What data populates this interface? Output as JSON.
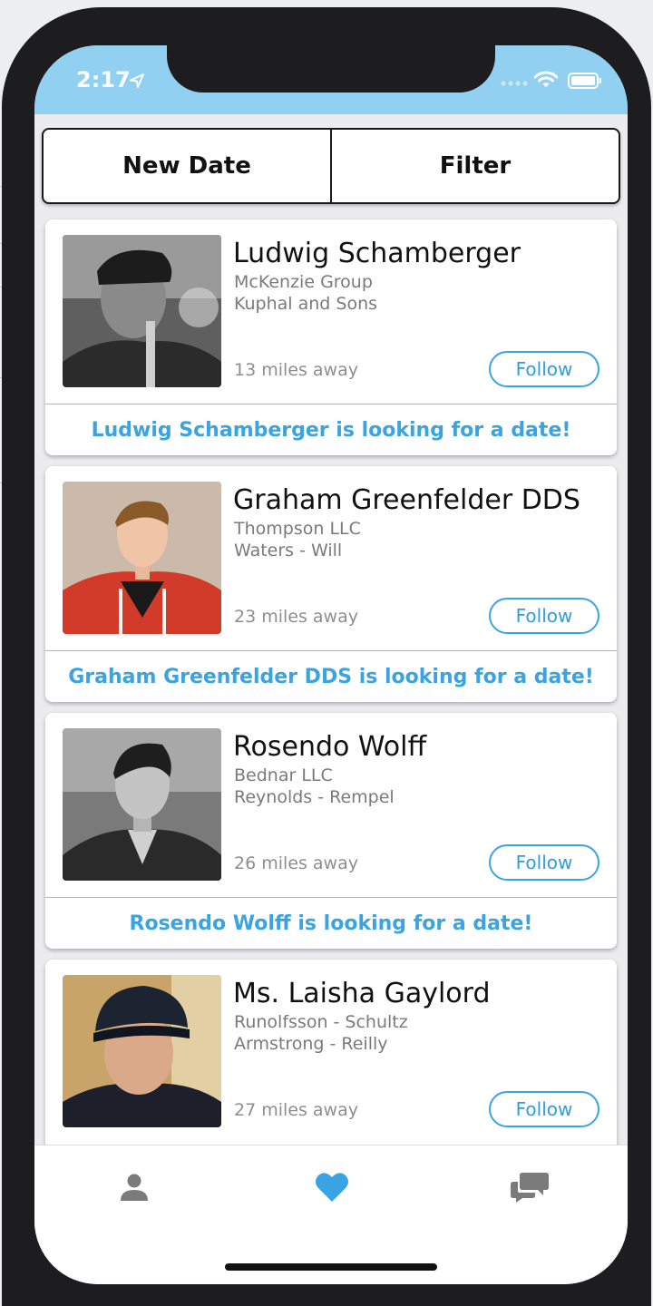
{
  "status_bar": {
    "time": "2:17"
  },
  "top_buttons": {
    "new_date": "New Date",
    "filter": "Filter"
  },
  "profiles": [
    {
      "name": "Ludwig Schamberger",
      "company1": "McKenzie Group",
      "company2": "Kuphal and Sons",
      "distance": "13  miles away",
      "follow_label": "Follow",
      "banner": "Ludwig Schamberger is looking for a date!"
    },
    {
      "name": "Graham Greenfelder DDS",
      "company1": "Thompson LLC",
      "company2": "Waters - Will",
      "distance": "23  miles away",
      "follow_label": "Follow",
      "banner": "Graham Greenfelder DDS is looking for a date!"
    },
    {
      "name": "Rosendo Wolff",
      "company1": "Bednar LLC",
      "company2": "Reynolds - Rempel",
      "distance": "26  miles away",
      "follow_label": "Follow",
      "banner": "Rosendo Wolff is looking for a date!"
    },
    {
      "name": "Ms. Laisha Gaylord",
      "company1": "Runolfsson - Schultz",
      "company2": "Armstrong - Reilly",
      "distance": "27  miles away",
      "follow_label": "Follow",
      "banner": ""
    }
  ],
  "tab_bar": {
    "items": [
      "profile-icon",
      "heart-icon",
      "chat-icon"
    ],
    "active_color": "#3aa3e3",
    "inactive_color": "#7b7b7b"
  },
  "colors": {
    "accent": "#3aa3e3",
    "status_bar": "#92d0f2"
  }
}
